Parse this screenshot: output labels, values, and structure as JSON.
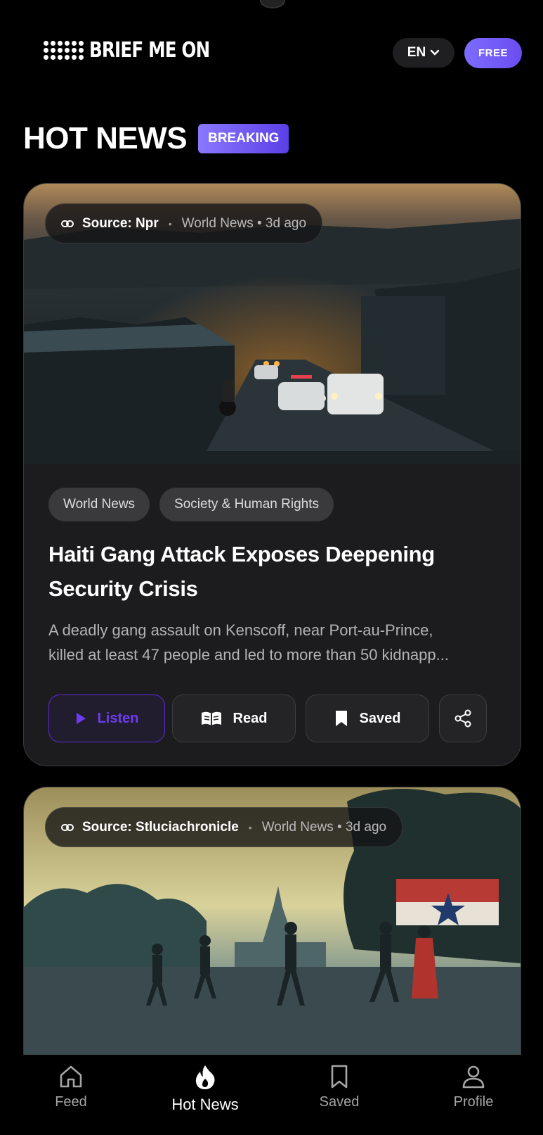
{
  "header": {
    "logo_text": "BRIEF ME ON",
    "language": "EN",
    "plan_badge": "FREE"
  },
  "page": {
    "title": "HOT NEWS",
    "badge": "BREAKING"
  },
  "articles": [
    {
      "source": "Source: Npr",
      "meta": "World News • 3d ago",
      "tags": [
        "World News",
        "Society & Human Rights"
      ],
      "headline": "Haiti Gang Attack Exposes Deepening Security Crisis",
      "summary_line1": "A deadly gang assault on Kenscoff, near Port-au-Prince,",
      "summary_line2": "killed at least 47 people and led to more than 50 kidnapp...",
      "actions": {
        "listen": "Listen",
        "read": "Read",
        "saved": "Saved"
      }
    },
    {
      "source": "Source: Stluciachronicle",
      "meta": "World News • 3d ago"
    }
  ],
  "bottom_nav": {
    "feed": "Feed",
    "hot_news": "Hot News",
    "saved": "Saved",
    "profile": "Profile"
  },
  "icons": [
    "link-icon",
    "chevron-down-icon",
    "play-icon",
    "book-open-icon",
    "bookmark-icon",
    "share-icon",
    "home-icon",
    "flame-icon",
    "profile-icon"
  ],
  "colors": {
    "accent": "#6d3cf0",
    "badge_gradient_start": "#8a78ff",
    "background": "#000000",
    "card": "#1c1c1e"
  }
}
